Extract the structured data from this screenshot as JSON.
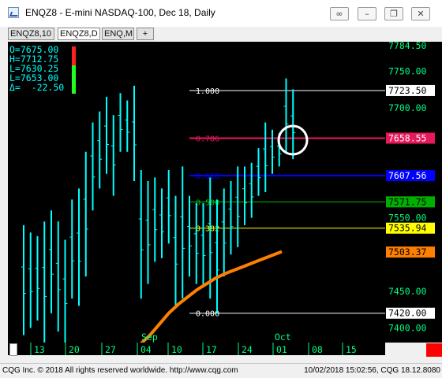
{
  "window": {
    "title": "ENQZ8 - E-mini NASDAQ-100, Dec 18, Daily",
    "link_icon": "link-icon",
    "minimize_icon": "minimize-icon",
    "restore_icon": "restore-icon",
    "close_icon": "close-icon"
  },
  "tabs": [
    {
      "label": "ENQZ8,10"
    },
    {
      "label": "ENQZ8,D"
    },
    {
      "label": "ENQ,M"
    },
    {
      "label": "+"
    }
  ],
  "ohlc": {
    "open": "O=7675.00",
    "high": "H=7712.75",
    "low": "L=7630.25",
    "last": "L=7653.00",
    "change": "Δ=  -22.50"
  },
  "price_axis": {
    "top_label": "7784.50",
    "ticks": [
      "7750.00",
      "7700.00",
      "7550.00",
      "7450.00",
      "7400.00"
    ],
    "markers": [
      {
        "label": "7723.50",
        "price": 7723.5,
        "bg": "#ffffff",
        "fg": "#000000"
      },
      {
        "label": "7658.55",
        "price": 7658.55,
        "bg": "#e6195b",
        "fg": "#ffffff"
      },
      {
        "label": "7607.56",
        "price": 7607.56,
        "bg": "#0000ff",
        "fg": "#ffffff"
      },
      {
        "label": "7571.75",
        "price": 7571.75,
        "bg": "#00b000",
        "fg": "#000000"
      },
      {
        "label": "7535.94",
        "price": 7535.94,
        "bg": "#ffff00",
        "fg": "#000000"
      },
      {
        "label": "7503.37",
        "price": 7503.37,
        "bg": "#ff8000",
        "fg": "#000000"
      },
      {
        "label": "7420.00",
        "price": 7420.0,
        "bg": "#ffffff",
        "fg": "#000000"
      }
    ]
  },
  "fib_levels": [
    {
      "label": "1.000",
      "price": 7723.5,
      "color": "#ffffff"
    },
    {
      "label": "0.786",
      "price": 7658.55,
      "color": "#e6195b"
    },
    {
      "label": "0.618",
      "price": 7607.56,
      "color": "#0000ff"
    },
    {
      "label": "0.500",
      "price": 7571.75,
      "color": "#00c000"
    },
    {
      "label": "0.382",
      "price": 7535.94,
      "color": "#ffff00"
    },
    {
      "label": "0.000",
      "price": 7420.0,
      "color": "#ffffff"
    }
  ],
  "date_axis": {
    "day_labels": [
      "13",
      "20",
      "27",
      "04",
      "10",
      "17",
      "24",
      "01",
      "08",
      "15"
    ],
    "month_labels": [
      "Sep",
      "Oct"
    ]
  },
  "status": {
    "left": "CQG Inc. © 2018 All rights reserved worldwide. http://www.cqg.com",
    "right": "10/02/2018 15:02:56, CQG 18.12.8080"
  },
  "colors": {
    "bars": "#00ffff",
    "moving_average": "#ff8000",
    "background": "#000000",
    "axis_text": "#00ff80"
  },
  "chart_data": {
    "type": "bar",
    "title": "ENQZ8 - E-mini NASDAQ-100, Dec 18, Daily",
    "ylim": [
      7380,
      7790
    ],
    "series": [
      {
        "name": "OHLC bars",
        "values": [
          {
            "h": 7540,
            "l": 7390
          },
          {
            "h": 7530,
            "l": 7400
          },
          {
            "h": 7525,
            "l": 7410
          },
          {
            "h": 7545,
            "l": 7380
          },
          {
            "h": 7560,
            "l": 7420
          },
          {
            "h": 7545,
            "l": 7395
          },
          {
            "h": 7520,
            "l": 7380
          },
          {
            "h": 7575,
            "l": 7440
          },
          {
            "h": 7590,
            "l": 7430
          },
          {
            "h": 7640,
            "l": 7470
          },
          {
            "h": 7680,
            "l": 7560
          },
          {
            "h": 7695,
            "l": 7590
          },
          {
            "h": 7715,
            "l": 7610
          },
          {
            "h": 7690,
            "l": 7580
          },
          {
            "h": 7720,
            "l": 7640
          },
          {
            "h": 7710,
            "l": 7640
          },
          {
            "h": 7730,
            "l": 7600
          },
          {
            "h": 7615,
            "l": 7440
          },
          {
            "h": 7600,
            "l": 7460
          },
          {
            "h": 7605,
            "l": 7490
          },
          {
            "h": 7590,
            "l": 7495
          },
          {
            "h": 7615,
            "l": 7515
          },
          {
            "h": 7580,
            "l": 7430
          },
          {
            "h": 7620,
            "l": 7440
          },
          {
            "h": 7580,
            "l": 7470
          },
          {
            "h": 7570,
            "l": 7460
          },
          {
            "h": 7570,
            "l": 7455
          },
          {
            "h": 7605,
            "l": 7440
          },
          {
            "h": 7575,
            "l": 7420
          },
          {
            "h": 7590,
            "l": 7470
          },
          {
            "h": 7600,
            "l": 7500
          },
          {
            "h": 7620,
            "l": 7510
          },
          {
            "h": 7620,
            "l": 7540
          },
          {
            "h": 7625,
            "l": 7550
          },
          {
            "h": 7645,
            "l": 7580
          },
          {
            "h": 7680,
            "l": 7585
          },
          {
            "h": 7670,
            "l": 7610
          },
          {
            "h": 7665,
            "l": 7620
          },
          {
            "h": 7740,
            "l": 7640
          },
          {
            "h": 7725,
            "l": 7630
          }
        ]
      },
      {
        "name": "Moving average",
        "values": [
          7378,
          7390,
          7405,
          7420,
          7432,
          7442,
          7452,
          7460,
          7468,
          7474,
          7479,
          7484,
          7489,
          7494,
          7499,
          7504
        ]
      }
    ]
  }
}
